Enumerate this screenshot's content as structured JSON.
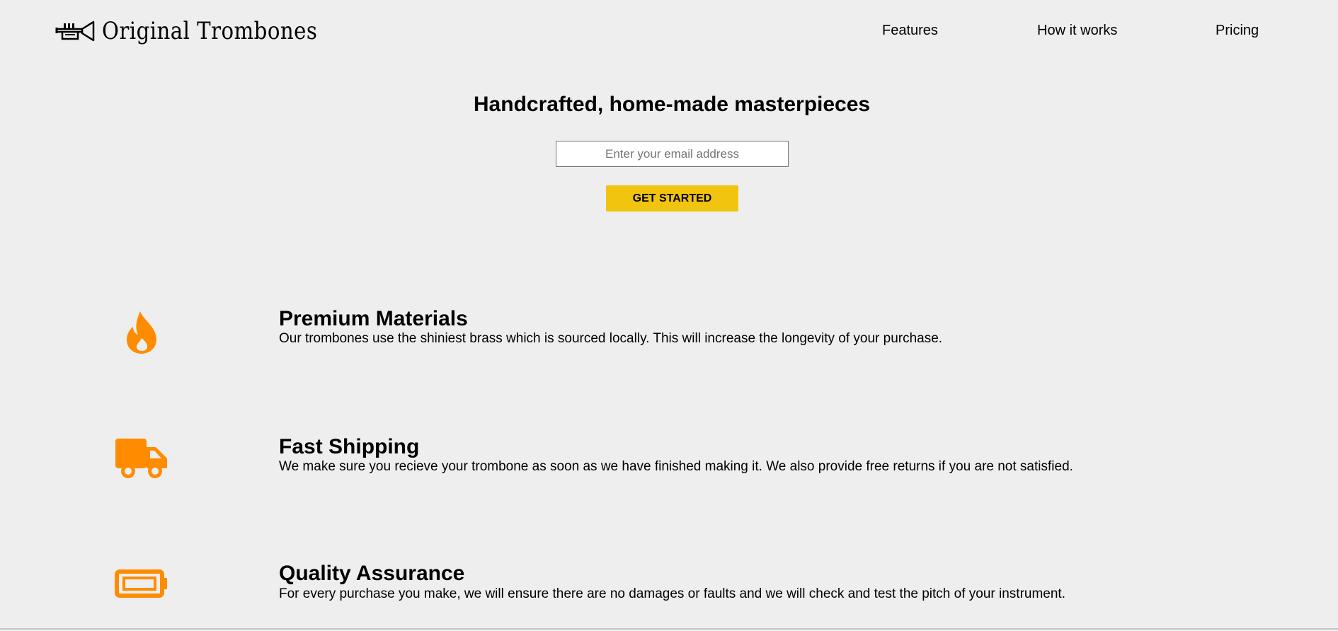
{
  "header": {
    "brand": "Original Trombones",
    "brand_icon": "trumpet-icon",
    "nav": [
      {
        "label": "Features"
      },
      {
        "label": "How it works"
      },
      {
        "label": "Pricing"
      }
    ]
  },
  "hero": {
    "title": "Handcrafted, home-made masterpieces",
    "email_placeholder": "Enter your email address",
    "email_value": "",
    "cta_label": "GET STARTED",
    "cta_color": "#f1c40f"
  },
  "features": [
    {
      "icon": "fire-icon",
      "title": "Premium Materials",
      "description": "Our trombones use the shiniest brass which is sourced locally. This will increase the longevity of your purchase."
    },
    {
      "icon": "truck-icon",
      "title": "Fast Shipping",
      "description": "We make sure you recieve your trombone as soon as we have finished making it. We also provide free returns if you are not satisfied."
    },
    {
      "icon": "battery-icon",
      "title": "Quality Assurance",
      "description": "For every purchase you make, we will ensure there are no damages or faults and we will check and test the pitch of your instrument."
    }
  ],
  "colors": {
    "background": "#eeeeee",
    "icon_accent": "#ff8c00",
    "button": "#f1c40f"
  }
}
